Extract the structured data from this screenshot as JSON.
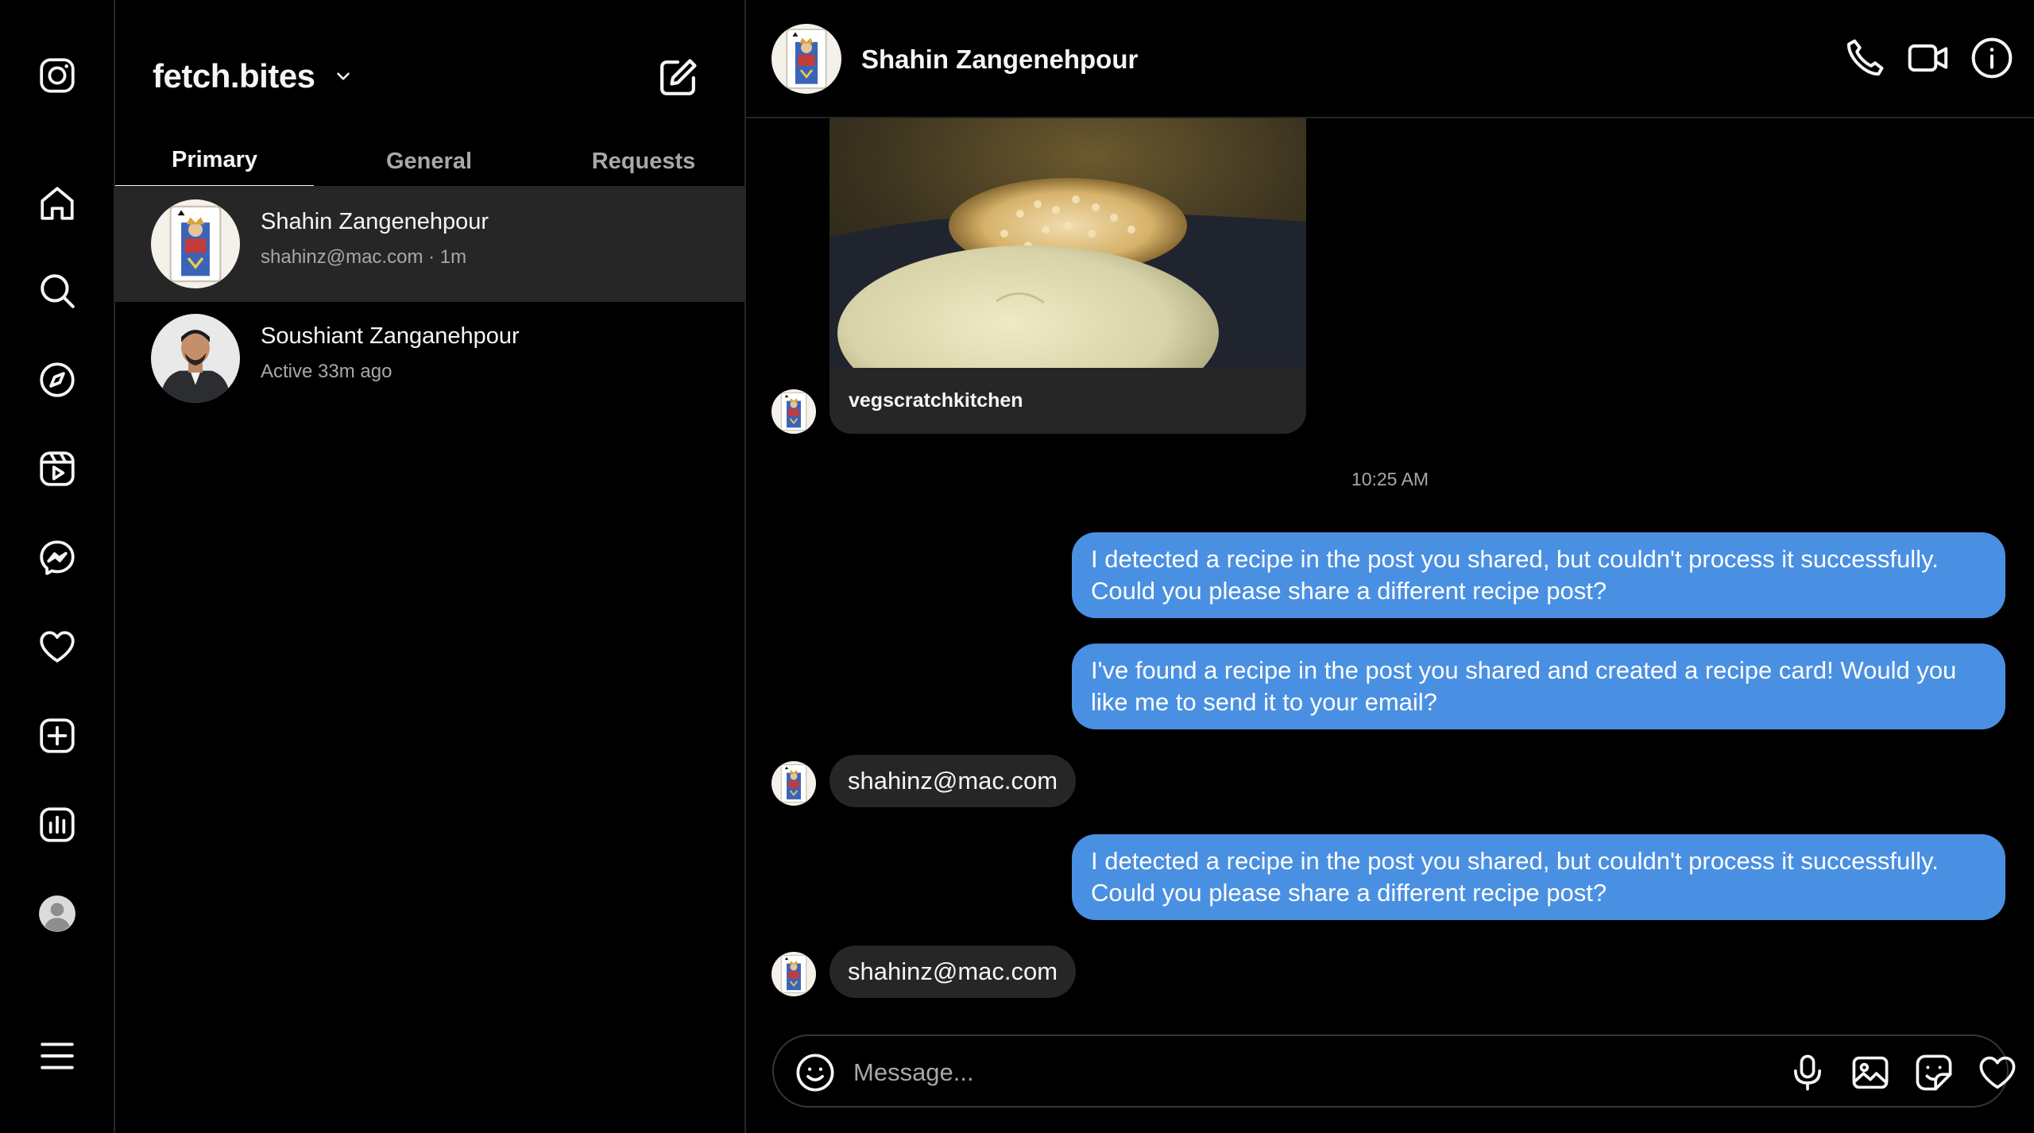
{
  "rail": {
    "icons": [
      "instagram-logo-icon",
      "home-icon",
      "search-icon",
      "explore-icon",
      "reels-icon",
      "messenger-icon",
      "notifications-heart-icon",
      "create-icon",
      "dashboard-icon",
      "profile-icon",
      "menu-icon"
    ]
  },
  "sidebar": {
    "account_name": "fetch.bites",
    "tabs": [
      {
        "label": "Primary",
        "active": true
      },
      {
        "label": "General",
        "active": false
      },
      {
        "label": "Requests",
        "active": false
      }
    ],
    "conversations": [
      {
        "name": "Shahin Zangenehpour",
        "subtitle": "shahinz@mac.com · 1m",
        "selected": true
      },
      {
        "name": "Soushiant Zanganehpour",
        "subtitle": "Active 33m ago",
        "selected": false
      }
    ]
  },
  "chat": {
    "header_name": "Shahin Zangenehpour",
    "shared_post_username": "vegscratchkitchen",
    "timestamp": "10:25 AM",
    "messages": [
      {
        "direction": "out",
        "text": "I detected a recipe in the post you shared, but couldn't process it successfully. Could you please share a different recipe post?"
      },
      {
        "direction": "out",
        "text": "I've found a recipe in the post you shared and created a recipe card! Would you like me to send it to your email?"
      },
      {
        "direction": "in",
        "text": "shahinz@mac.com"
      },
      {
        "direction": "out",
        "text": "I detected a recipe in the post you shared, but couldn't process it successfully. Could you please share a different recipe post?"
      },
      {
        "direction": "in",
        "text": "shahinz@mac.com"
      }
    ],
    "composer_placeholder": "Message..."
  },
  "colors": {
    "background": "#000000",
    "panel_border": "#262626",
    "selected_row": "#262626",
    "incoming_bubble": "#262626",
    "outgoing_bubble": "#4a90e2",
    "muted_text": "#a8a8a8"
  }
}
